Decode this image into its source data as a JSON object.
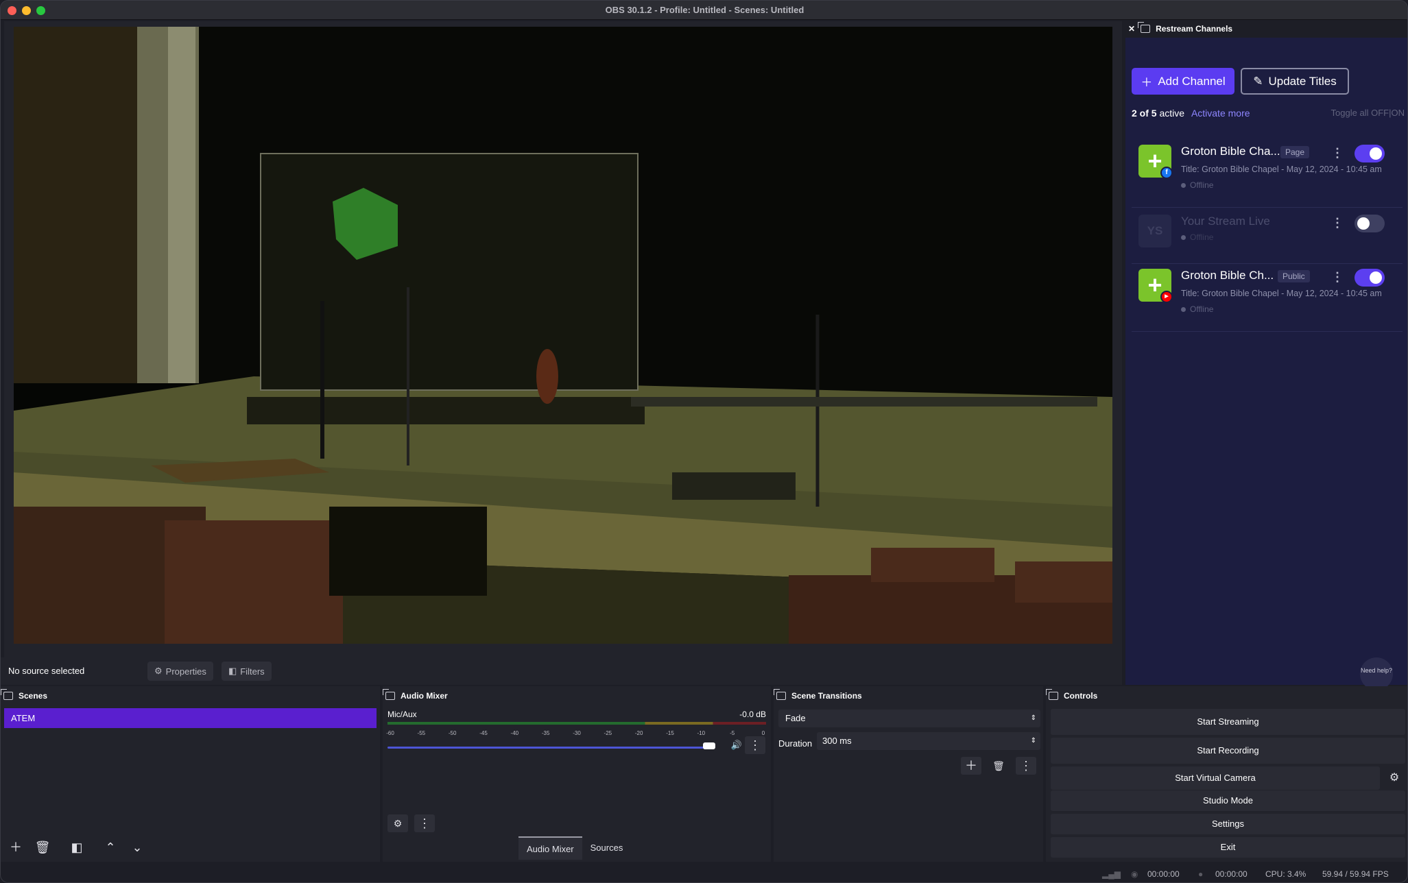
{
  "window": {
    "title": "OBS 30.1.2 - Profile: Untitled - Scenes: Untitled"
  },
  "source_bar": {
    "no_source": "No source selected",
    "properties": "Properties",
    "filters": "Filters"
  },
  "restream": {
    "panel_title": "Restream Channels",
    "add_channel": "Add Channel",
    "update_titles": "Update Titles",
    "active_count": "2 of 5",
    "active_suffix": "active",
    "activate_more": "Activate more",
    "toggle_all": "Toggle all",
    "toggle_off": "OFF",
    "toggle_on": "ON",
    "channels": [
      {
        "name": "Groton Bible Cha...",
        "tag": "Page",
        "title": "Title: Groton Bible Chapel - May 12, 2024 - 10:45 am",
        "status": "Offline",
        "enabled": true,
        "platform": "facebook",
        "platform_icon": "f"
      },
      {
        "name": "Your Stream Live",
        "logo_text": "YS",
        "status": "Offline",
        "enabled": false
      },
      {
        "name": "Groton Bible Ch...",
        "tag": "Public",
        "title": "Title: Groton Bible Chapel - May 12, 2024 - 10:45 am",
        "status": "Offline",
        "enabled": true,
        "platform": "youtube",
        "platform_icon": "▶"
      }
    ],
    "help": "Need help?",
    "accent": "#5b3cf1"
  },
  "docks": {
    "scenes": {
      "title": "Scenes",
      "items": [
        "ATEM"
      ]
    },
    "mixer": {
      "title": "Audio Mixer",
      "channel": "Mic/Aux",
      "level": "-0.0 dB",
      "ticks": [
        "-60",
        "-55",
        "-50",
        "-45",
        "-40",
        "-35",
        "-30",
        "-25",
        "-20",
        "-15",
        "-10",
        "-5",
        "0"
      ],
      "volume_fraction": 0.95
    },
    "transitions": {
      "title": "Scene Transitions",
      "selected": "Fade",
      "duration_label": "Duration",
      "duration": "300 ms"
    },
    "controls": {
      "title": "Controls",
      "start_streaming": "Start Streaming",
      "start_recording": "Start Recording",
      "start_virtual_camera": "Start Virtual Camera",
      "studio_mode": "Studio Mode",
      "settings": "Settings",
      "exit": "Exit"
    }
  },
  "bottom_tabs": [
    "Audio Mixer",
    "Sources"
  ],
  "status": {
    "stream_time": "00:00:00",
    "rec_time": "00:00:00",
    "cpu": "CPU: 3.4%",
    "fps": "59.94 / 59.94 FPS"
  }
}
